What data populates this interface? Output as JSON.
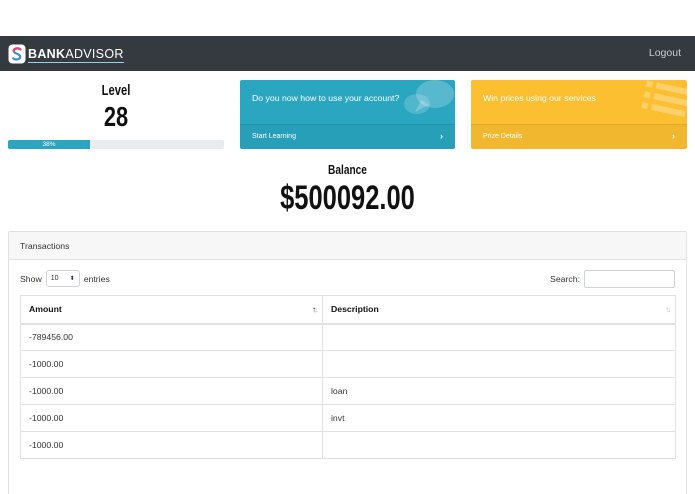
{
  "navbar": {
    "brand_bold": "BANK",
    "brand_rest": "ADVISOR",
    "logout_label": "Logout"
  },
  "level": {
    "label": "Level",
    "value": "28",
    "progress_label": "38%",
    "progress_percent": 38
  },
  "cards": {
    "learning": {
      "title": "Do you now how to use your account?",
      "footer_label": "Start Learning",
      "icon": "chat-bubbles-icon",
      "color": "#2aa6c1"
    },
    "prizes": {
      "title": "Win prices using our services",
      "footer_label": "Prize Details",
      "icon": "list-icon",
      "color": "#fbbf31"
    }
  },
  "balance": {
    "label": "Balance",
    "value": "$500092.00"
  },
  "transactions": {
    "title": "Transactions",
    "show_prefix": "Show",
    "entries_value": "10",
    "show_suffix": "entries",
    "search_label": "Search:",
    "columns": [
      "Amount",
      "Description"
    ],
    "rows": [
      {
        "amount": "-789456.00",
        "description": ""
      },
      {
        "amount": "-1000.00",
        "description": ""
      },
      {
        "amount": "-1000.00",
        "description": "loan"
      },
      {
        "amount": "-1000.00",
        "description": "invt"
      },
      {
        "amount": "-1000.00",
        "description": ""
      }
    ]
  },
  "colors": {
    "navbar": "#343a40",
    "accent": "#2aa6c1",
    "warning": "#fbbf31",
    "negative": "#d9232d"
  }
}
